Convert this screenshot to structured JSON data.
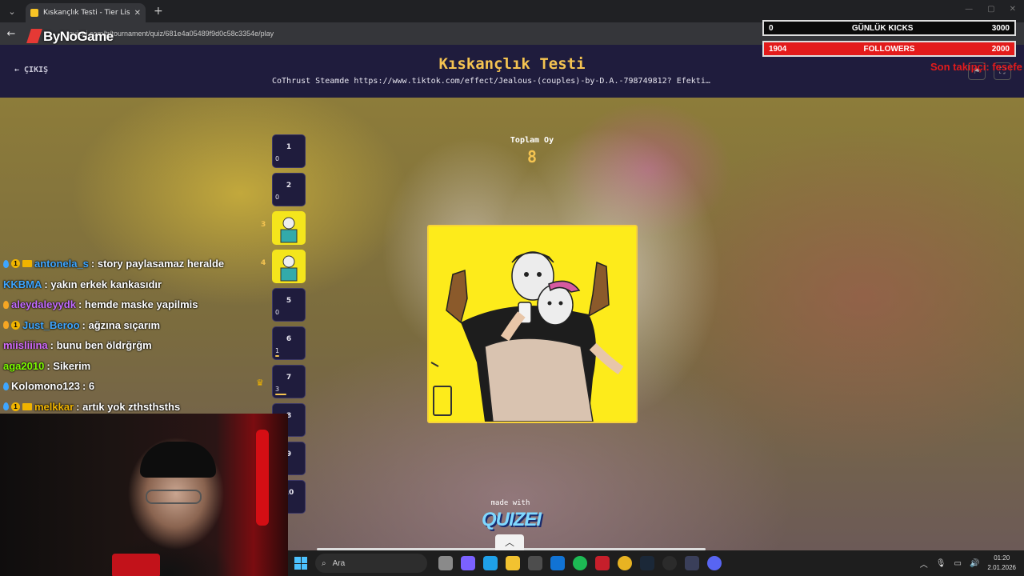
{
  "browser": {
    "tab_title": "Kıskançlık Testi - Tier List, Kör S…",
    "tab_close": "✕",
    "new_tab": "+",
    "url": "quizei.com/tr/tournament/quiz/681e4a05489f9d0c58c3354e/play",
    "bynogame_logo": "ByNoGame"
  },
  "overlay": {
    "kicks_value": "0",
    "kicks_label": "GÜNLÜK KICKS",
    "kicks_goal": "3000",
    "followers_value": "1904",
    "followers_label": "FOLLOWERS",
    "followers_goal": "2000",
    "son_takip": "Son takipçi: fesefe"
  },
  "header": {
    "exit_label": "ÇIKIŞ",
    "title": "Kıskançlık Testi",
    "subtitle": "CoThrust Steamde https://www.tiktok.com/effect/Jealous-(couples)-by-D.A.-798749812? Efekti…"
  },
  "votes": {
    "label": "Toplam Oy",
    "value": "8"
  },
  "bracket": [
    {
      "n": "1",
      "v": "0",
      "bar": 0
    },
    {
      "n": "2",
      "v": "0",
      "bar": 0
    },
    {
      "n": "",
      "v": "",
      "bar": 0,
      "side": "3"
    },
    {
      "n": "",
      "v": "",
      "bar": 0,
      "side": "4"
    },
    {
      "n": "5",
      "v": "0",
      "bar": 0
    },
    {
      "n": "6",
      "v": "1",
      "bar": 0.125
    },
    {
      "n": "7",
      "v": "3",
      "bar": 0.375
    },
    {
      "n": "8",
      "v": "",
      "bar": 0
    },
    {
      "n": "9",
      "v": "",
      "bar": 0
    },
    {
      "n": "10",
      "v": "",
      "bar": 0
    }
  ],
  "chat": [
    {
      "user": "antonela_s",
      "color": "#3ea6ff",
      "msg": ": story paylasamaz heralde"
    },
    {
      "user": "KKBMA",
      "color": "#3ea6ff",
      "msg": ": yakın erkek kankasıdır"
    },
    {
      "user": "aleydaleyydk",
      "color": "#c36bff",
      "msg": ": hemde maske yapilmis"
    },
    {
      "user": "Just_Beroo",
      "color": "#3ea6ff",
      "msg": ": ağzına sıçarım"
    },
    {
      "user": "miisliiina",
      "color": "#d46bff",
      "msg": ": bunu ben öldrğrğm"
    },
    {
      "user": "aga2010",
      "color": "#7cfc00",
      "msg": ": Sikerim"
    },
    {
      "user": "Kolomono123",
      "color": "#ffffff",
      "msg": ": 6"
    },
    {
      "user": "melkkar",
      "color": "#f0b400",
      "msg": ": artık yok zthsthsths"
    }
  ],
  "footer": {
    "made_with": "made with",
    "brand": "QUIZEI",
    "scroll_up": "︿"
  },
  "taskbar": {
    "search_placeholder": "Ara",
    "time": "01:20",
    "date": "2.01.2026"
  }
}
